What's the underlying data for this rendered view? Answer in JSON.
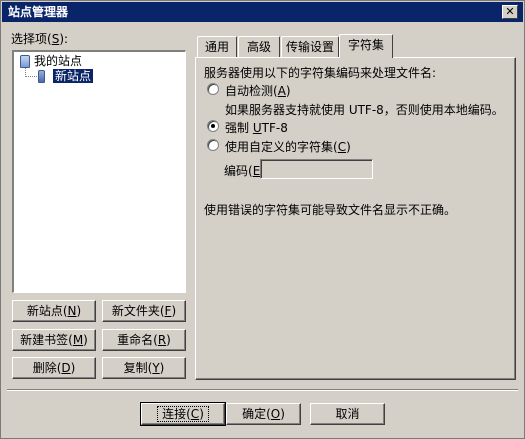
{
  "window": {
    "title": "站点管理器",
    "close_glyph": "✕"
  },
  "sidebar": {
    "label_prefix": "选择项(",
    "label_key": "S",
    "label_suffix": "):",
    "tree": {
      "root": "我的站点",
      "child": "新站点"
    },
    "buttons": {
      "new_site": {
        "text": "新站点(",
        "key": "N",
        "end": ")"
      },
      "new_folder": {
        "text": "新文件夹(",
        "key": "F",
        "end": ")"
      },
      "new_bookmark": {
        "text": "新建书签(",
        "key": "M",
        "end": ")"
      },
      "rename": {
        "text": "重命名(",
        "key": "R",
        "end": ")"
      },
      "delete": {
        "text": "删除(",
        "key": "D",
        "end": ")"
      },
      "copy": {
        "text": "复制(",
        "key": "Y",
        "end": ")"
      }
    }
  },
  "tabs": [
    {
      "label": "通用"
    },
    {
      "label": "高级"
    },
    {
      "label": "传输设置"
    },
    {
      "label": "字符集"
    }
  ],
  "charset_panel": {
    "intro": "服务器使用以下的字符集编码来处理文件名:",
    "auto_detect": {
      "text": "自动检测(",
      "key": "A",
      "end": ")",
      "checked": false
    },
    "auto_detect_note": "如果服务器支持就使用 UTF-8，否则使用本地编码。",
    "force_utf8": {
      "text": "强制 ",
      "key": "U",
      "end": "TF-8",
      "checked": true
    },
    "custom": {
      "text": "使用自定义的字符集(",
      "key": "C",
      "end": ")",
      "checked": false
    },
    "encoding_label": {
      "text": "编码(",
      "key": "E",
      "end": "):"
    },
    "encoding_value": "",
    "warning": "使用错误的字符集可能导致文件名显示不正确。"
  },
  "footer": {
    "connect": {
      "text": "连接(",
      "key": "C",
      "end": ")"
    },
    "ok": {
      "text": "确定(",
      "key": "O",
      "end": ")"
    },
    "cancel": {
      "text": "取消"
    }
  }
}
